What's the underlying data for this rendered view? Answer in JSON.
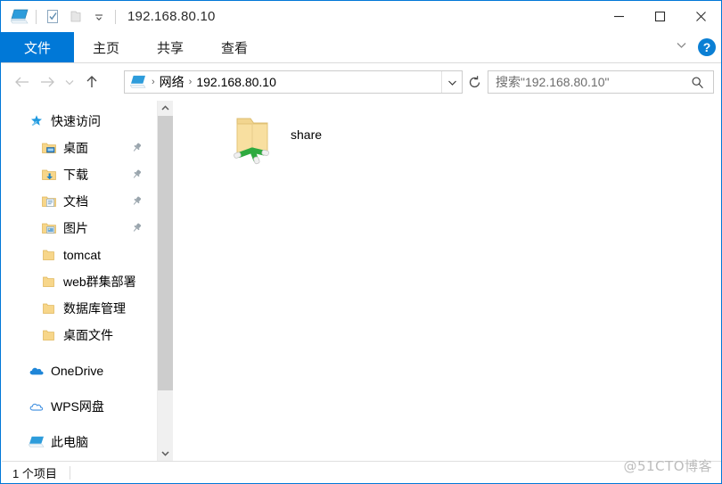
{
  "window": {
    "title": "192.168.80.10",
    "quick_access_toolbar": [
      {
        "name": "pc-icon",
        "label": "此电脑"
      },
      {
        "name": "properties-icon",
        "label": "属性"
      },
      {
        "name": "new-folder-icon",
        "label": "新建文件夹"
      },
      {
        "name": "customize-dropdown-icon",
        "label": "自定义快速访问工具栏"
      }
    ],
    "controls": {
      "minimize": "—",
      "maximize": "□",
      "close": "✕"
    }
  },
  "ribbon": {
    "tabs": [
      {
        "label": "文件",
        "active": true
      },
      {
        "label": "主页",
        "active": false
      },
      {
        "label": "共享",
        "active": false
      },
      {
        "label": "查看",
        "active": false
      }
    ],
    "expand_label": "⌵",
    "help_label": "?"
  },
  "nav": {
    "back_label": "后退",
    "forward_label": "前进",
    "recent_label": "最近浏览的位置",
    "up_label": "上移一级",
    "refresh_label": "刷新"
  },
  "address": {
    "crumbs": [
      "网络",
      "192.168.80.10"
    ],
    "separator": "›",
    "dropdown_label": "⌄"
  },
  "search": {
    "placeholder": "搜索\"192.168.80.10\"",
    "value": ""
  },
  "sidebar": {
    "items": [
      {
        "label": "快速访问",
        "icon": "star-pin-icon",
        "level": "root",
        "pinned": false
      },
      {
        "label": "桌面",
        "icon": "desktop-folder-icon",
        "level": "child",
        "pinned": true
      },
      {
        "label": "下载",
        "icon": "downloads-folder-icon",
        "level": "child",
        "pinned": true
      },
      {
        "label": "文档",
        "icon": "documents-folder-icon",
        "level": "child",
        "pinned": true
      },
      {
        "label": "图片",
        "icon": "pictures-folder-icon",
        "level": "child",
        "pinned": true
      },
      {
        "label": "tomcat",
        "icon": "folder-icon",
        "level": "child",
        "pinned": false
      },
      {
        "label": "web群集部署",
        "icon": "folder-icon",
        "level": "child",
        "pinned": false
      },
      {
        "label": "数据库管理",
        "icon": "folder-icon",
        "level": "child",
        "pinned": false
      },
      {
        "label": "桌面文件",
        "icon": "folder-icon",
        "level": "child",
        "pinned": false
      },
      {
        "label": "OneDrive",
        "icon": "onedrive-cloud-icon",
        "level": "root",
        "pinned": false
      },
      {
        "label": "WPS网盘",
        "icon": "wps-cloud-icon",
        "level": "root",
        "pinned": false
      },
      {
        "label": "此电脑",
        "icon": "pc-icon",
        "level": "root",
        "pinned": false
      }
    ],
    "scroll_up_label": "⌃",
    "scroll_down_label": "⌄"
  },
  "content": {
    "files": [
      {
        "name": "share",
        "icon": "shared-folder-icon",
        "type": "共享文件夹"
      }
    ]
  },
  "statusbar": {
    "item_count_text": "1 个项目"
  },
  "watermark": {
    "text": "@51CTO博客"
  },
  "colors": {
    "accent": "#0078d7",
    "window_border": "#0078d7",
    "folder_yellow": "#f7d68a",
    "share_green": "#2eaa3f",
    "scrollbar_thumb": "#cdcdcd"
  }
}
